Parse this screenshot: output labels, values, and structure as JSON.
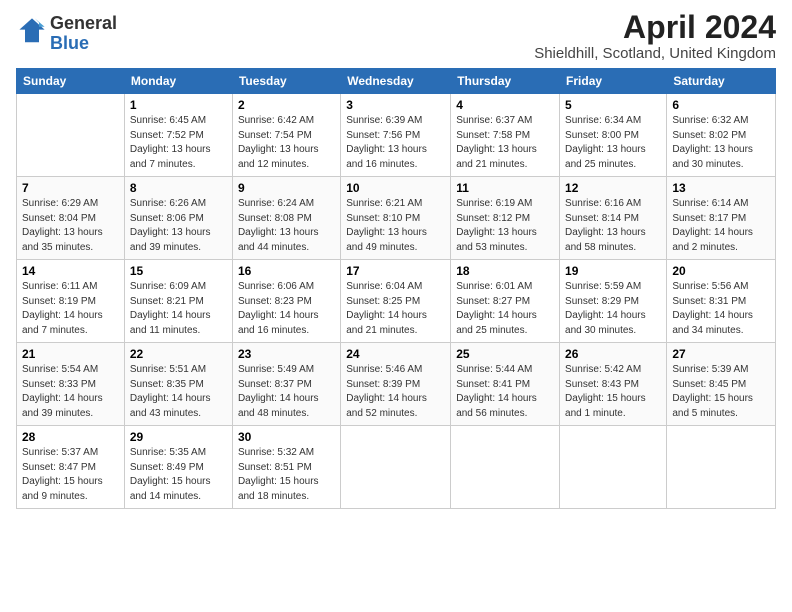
{
  "logo": {
    "line1": "General",
    "line2": "Blue"
  },
  "title": "April 2024",
  "subtitle": "Shieldhill, Scotland, United Kingdom",
  "weekdays": [
    "Sunday",
    "Monday",
    "Tuesday",
    "Wednesday",
    "Thursday",
    "Friday",
    "Saturday"
  ],
  "weeks": [
    [
      {
        "day": "",
        "info": ""
      },
      {
        "day": "1",
        "info": "Sunrise: 6:45 AM\nSunset: 7:52 PM\nDaylight: 13 hours\nand 7 minutes."
      },
      {
        "day": "2",
        "info": "Sunrise: 6:42 AM\nSunset: 7:54 PM\nDaylight: 13 hours\nand 12 minutes."
      },
      {
        "day": "3",
        "info": "Sunrise: 6:39 AM\nSunset: 7:56 PM\nDaylight: 13 hours\nand 16 minutes."
      },
      {
        "day": "4",
        "info": "Sunrise: 6:37 AM\nSunset: 7:58 PM\nDaylight: 13 hours\nand 21 minutes."
      },
      {
        "day": "5",
        "info": "Sunrise: 6:34 AM\nSunset: 8:00 PM\nDaylight: 13 hours\nand 25 minutes."
      },
      {
        "day": "6",
        "info": "Sunrise: 6:32 AM\nSunset: 8:02 PM\nDaylight: 13 hours\nand 30 minutes."
      }
    ],
    [
      {
        "day": "7",
        "info": "Sunrise: 6:29 AM\nSunset: 8:04 PM\nDaylight: 13 hours\nand 35 minutes."
      },
      {
        "day": "8",
        "info": "Sunrise: 6:26 AM\nSunset: 8:06 PM\nDaylight: 13 hours\nand 39 minutes."
      },
      {
        "day": "9",
        "info": "Sunrise: 6:24 AM\nSunset: 8:08 PM\nDaylight: 13 hours\nand 44 minutes."
      },
      {
        "day": "10",
        "info": "Sunrise: 6:21 AM\nSunset: 8:10 PM\nDaylight: 13 hours\nand 49 minutes."
      },
      {
        "day": "11",
        "info": "Sunrise: 6:19 AM\nSunset: 8:12 PM\nDaylight: 13 hours\nand 53 minutes."
      },
      {
        "day": "12",
        "info": "Sunrise: 6:16 AM\nSunset: 8:14 PM\nDaylight: 13 hours\nand 58 minutes."
      },
      {
        "day": "13",
        "info": "Sunrise: 6:14 AM\nSunset: 8:17 PM\nDaylight: 14 hours\nand 2 minutes."
      }
    ],
    [
      {
        "day": "14",
        "info": "Sunrise: 6:11 AM\nSunset: 8:19 PM\nDaylight: 14 hours\nand 7 minutes."
      },
      {
        "day": "15",
        "info": "Sunrise: 6:09 AM\nSunset: 8:21 PM\nDaylight: 14 hours\nand 11 minutes."
      },
      {
        "day": "16",
        "info": "Sunrise: 6:06 AM\nSunset: 8:23 PM\nDaylight: 14 hours\nand 16 minutes."
      },
      {
        "day": "17",
        "info": "Sunrise: 6:04 AM\nSunset: 8:25 PM\nDaylight: 14 hours\nand 21 minutes."
      },
      {
        "day": "18",
        "info": "Sunrise: 6:01 AM\nSunset: 8:27 PM\nDaylight: 14 hours\nand 25 minutes."
      },
      {
        "day": "19",
        "info": "Sunrise: 5:59 AM\nSunset: 8:29 PM\nDaylight: 14 hours\nand 30 minutes."
      },
      {
        "day": "20",
        "info": "Sunrise: 5:56 AM\nSunset: 8:31 PM\nDaylight: 14 hours\nand 34 minutes."
      }
    ],
    [
      {
        "day": "21",
        "info": "Sunrise: 5:54 AM\nSunset: 8:33 PM\nDaylight: 14 hours\nand 39 minutes."
      },
      {
        "day": "22",
        "info": "Sunrise: 5:51 AM\nSunset: 8:35 PM\nDaylight: 14 hours\nand 43 minutes."
      },
      {
        "day": "23",
        "info": "Sunrise: 5:49 AM\nSunset: 8:37 PM\nDaylight: 14 hours\nand 48 minutes."
      },
      {
        "day": "24",
        "info": "Sunrise: 5:46 AM\nSunset: 8:39 PM\nDaylight: 14 hours\nand 52 minutes."
      },
      {
        "day": "25",
        "info": "Sunrise: 5:44 AM\nSunset: 8:41 PM\nDaylight: 14 hours\nand 56 minutes."
      },
      {
        "day": "26",
        "info": "Sunrise: 5:42 AM\nSunset: 8:43 PM\nDaylight: 15 hours\nand 1 minute."
      },
      {
        "day": "27",
        "info": "Sunrise: 5:39 AM\nSunset: 8:45 PM\nDaylight: 15 hours\nand 5 minutes."
      }
    ],
    [
      {
        "day": "28",
        "info": "Sunrise: 5:37 AM\nSunset: 8:47 PM\nDaylight: 15 hours\nand 9 minutes."
      },
      {
        "day": "29",
        "info": "Sunrise: 5:35 AM\nSunset: 8:49 PM\nDaylight: 15 hours\nand 14 minutes."
      },
      {
        "day": "30",
        "info": "Sunrise: 5:32 AM\nSunset: 8:51 PM\nDaylight: 15 hours\nand 18 minutes."
      },
      {
        "day": "",
        "info": ""
      },
      {
        "day": "",
        "info": ""
      },
      {
        "day": "",
        "info": ""
      },
      {
        "day": "",
        "info": ""
      }
    ]
  ]
}
